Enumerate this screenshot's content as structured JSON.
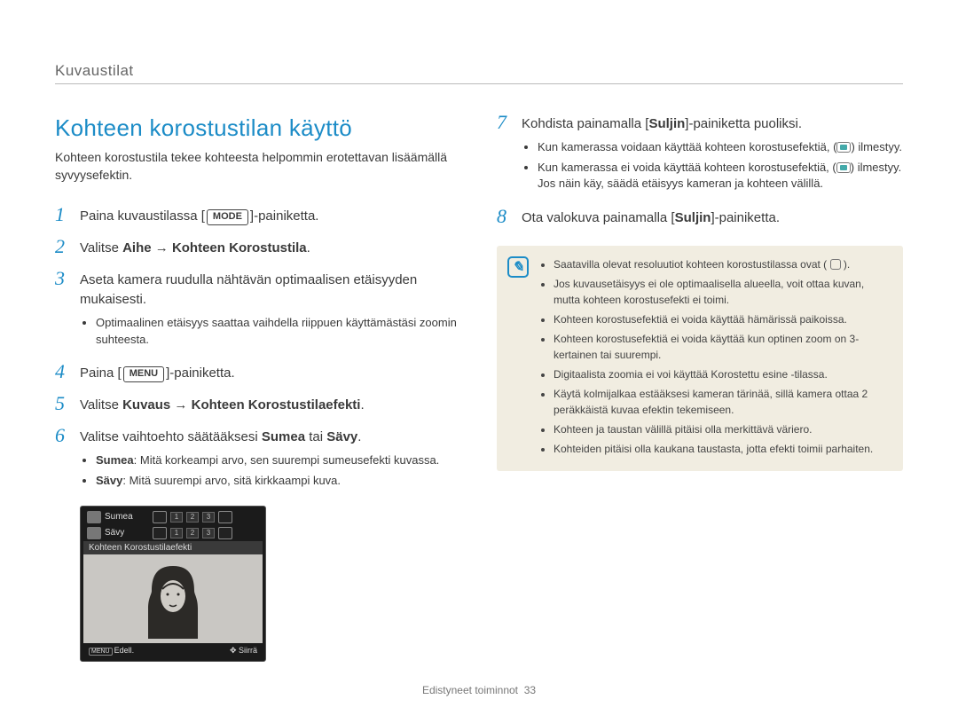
{
  "breadcrumb": "Kuvaustilat",
  "title": "Kohteen korostustilan käyttö",
  "intro": "Kohteen korostustila tekee kohteesta helpommin erotettavan lisäämällä syvyysefektin.",
  "left_steps": {
    "s1": {
      "num": "1",
      "pre": "Paina kuvaustilassa ",
      "btn": "MODE",
      "post": "-painiketta."
    },
    "s2": {
      "num": "2",
      "pre": "Valitse ",
      "b1": "Aihe",
      "arrow": " → ",
      "b2": "Kohteen Korostustila",
      "post": "."
    },
    "s3": {
      "num": "3",
      "text": "Aseta kamera ruudulla nähtävän optimaalisen etäisyyden mukaisesti.",
      "sub": [
        "Optimaalinen etäisyys saattaa vaihdella riippuen käyttämästäsi zoomin suhteesta."
      ]
    },
    "s4": {
      "num": "4",
      "pre": "Paina ",
      "btn": "MENU",
      "post": "-painiketta."
    },
    "s5": {
      "num": "5",
      "pre": "Valitse ",
      "b1": "Kuvaus",
      "arrow": " → ",
      "b2": "Kohteen Korostustilaefekti",
      "post": "."
    },
    "s6": {
      "num": "6",
      "pre": "Valitse vaihtoehto säätääksesi ",
      "b1": "Sumea",
      "mid": " tai ",
      "b2": "Sävy",
      "post": ".",
      "sub_b1": "Sumea",
      "sub_t1": ": Mitä korkeampi arvo, sen suurempi sumeusefekti kuvassa.",
      "sub_b2": "Sävy",
      "sub_t2": ": Mitä suurempi arvo, sitä kirkkaampi kuva."
    }
  },
  "screenshot": {
    "row1": "Sumea",
    "row2": "Sävy",
    "bar": "Kohteen Korostustilaefekti",
    "menu": "MENU",
    "back": "Edell.",
    "move": "Siirrä",
    "slots": [
      "1",
      "2",
      "3"
    ]
  },
  "right_steps": {
    "s7": {
      "num": "7",
      "pre": "Kohdista painamalla [",
      "b": "Suljin",
      "post": "]-painiketta puoliksi.",
      "sub1a": "Kun kamerassa voidaan käyttää kohteen korostusefektiä, (",
      "sub1b": ") ilmestyy.",
      "sub2a": "Kun kamerassa ei voida käyttää kohteen korostusefektiä, (",
      "sub2b": ") ilmestyy. Jos näin käy, säädä etäisyys kameran ja kohteen välillä."
    },
    "s8": {
      "num": "8",
      "pre": "Ota valokuva painamalla [",
      "b": "Suljin",
      "post": "]-painiketta."
    }
  },
  "infobox": [
    {
      "pre": "Saatavilla olevat resoluutiot kohteen korostustilassa ovat ( ",
      "icon": true,
      "post": " )."
    },
    {
      "text": "Jos kuvausetäisyys ei ole optimaalisella alueella, voit ottaa kuvan, mutta kohteen korostusefekti ei toimi."
    },
    {
      "text": "Kohteen korostusefektiä ei voida käyttää hämärissä paikoissa."
    },
    {
      "text": "Kohteen korostusefektiä ei voida käyttää kun optinen zoom on 3-kertainen tai suurempi."
    },
    {
      "text": "Digitaalista zoomia ei voi käyttää Korostettu esine -tilassa."
    },
    {
      "text": "Käytä kolmijalkaa estääksesi kameran tärinää, sillä kamera ottaa 2 peräkkäistä kuvaa efektin tekemiseen."
    },
    {
      "text": "Kohteen ja taustan välillä pitäisi olla merkittävä väriero."
    },
    {
      "text": "Kohteiden pitäisi olla kaukana taustasta, jotta efekti toimii parhaiten."
    }
  ],
  "footer": {
    "section": "Edistyneet toiminnot",
    "page": "33"
  }
}
